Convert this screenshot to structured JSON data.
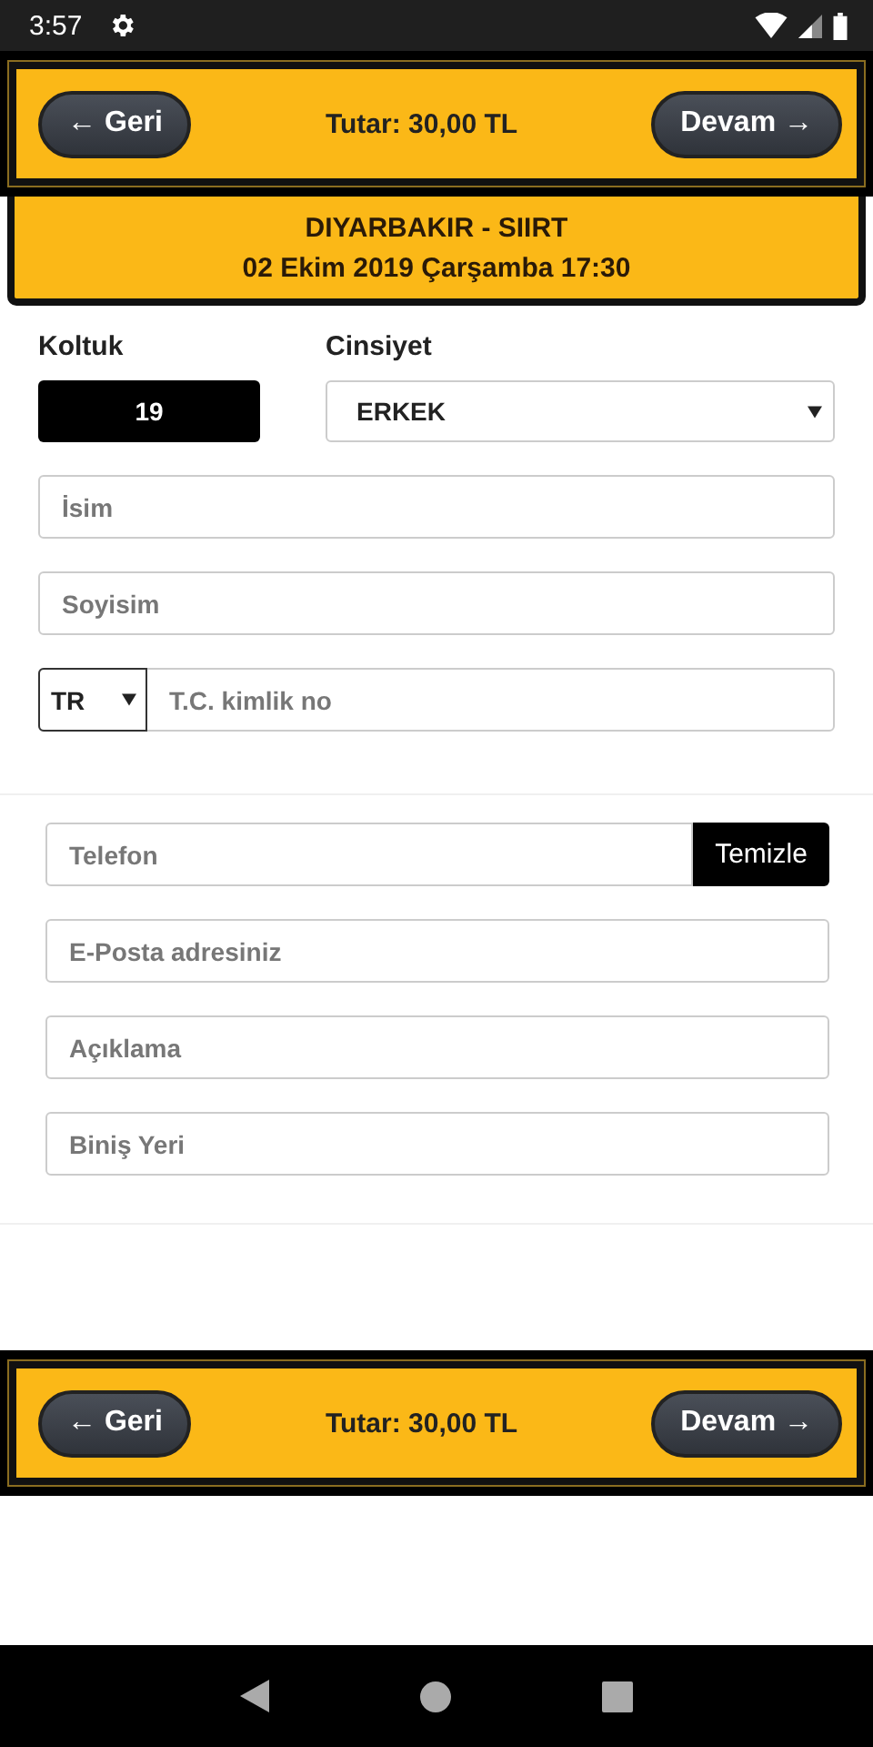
{
  "status_bar": {
    "time": "3:57"
  },
  "top_bar": {
    "back_button": "← Geri",
    "total": "Tutar: 30,00 TL",
    "next_button": "Devam →"
  },
  "trip": {
    "route": "DIYARBAKIR - SIIRT",
    "datetime": "02 Ekim 2019 Çarşamba 17:30"
  },
  "seat": {
    "label": "Koltuk",
    "value": "19"
  },
  "gender": {
    "label": "Cinsiyet",
    "value": "ERKEK"
  },
  "name_fields": [
    {
      "placeholder": "İsim"
    },
    {
      "placeholder": "Soyisim"
    }
  ],
  "id_field": {
    "country": "TR",
    "placeholder": "T.C. kimlik no"
  },
  "phone": {
    "placeholder": "Telefon",
    "clear_button": "Temizle"
  },
  "contact_fields": [
    {
      "placeholder": "E-Posta adresiniz"
    },
    {
      "placeholder": "Açıklama"
    },
    {
      "placeholder": "Biniş Yeri"
    }
  ],
  "bottom_bar": {
    "back_button": "← Geri",
    "total": "Tutar: 30,00 TL",
    "next_button": "Devam →"
  }
}
